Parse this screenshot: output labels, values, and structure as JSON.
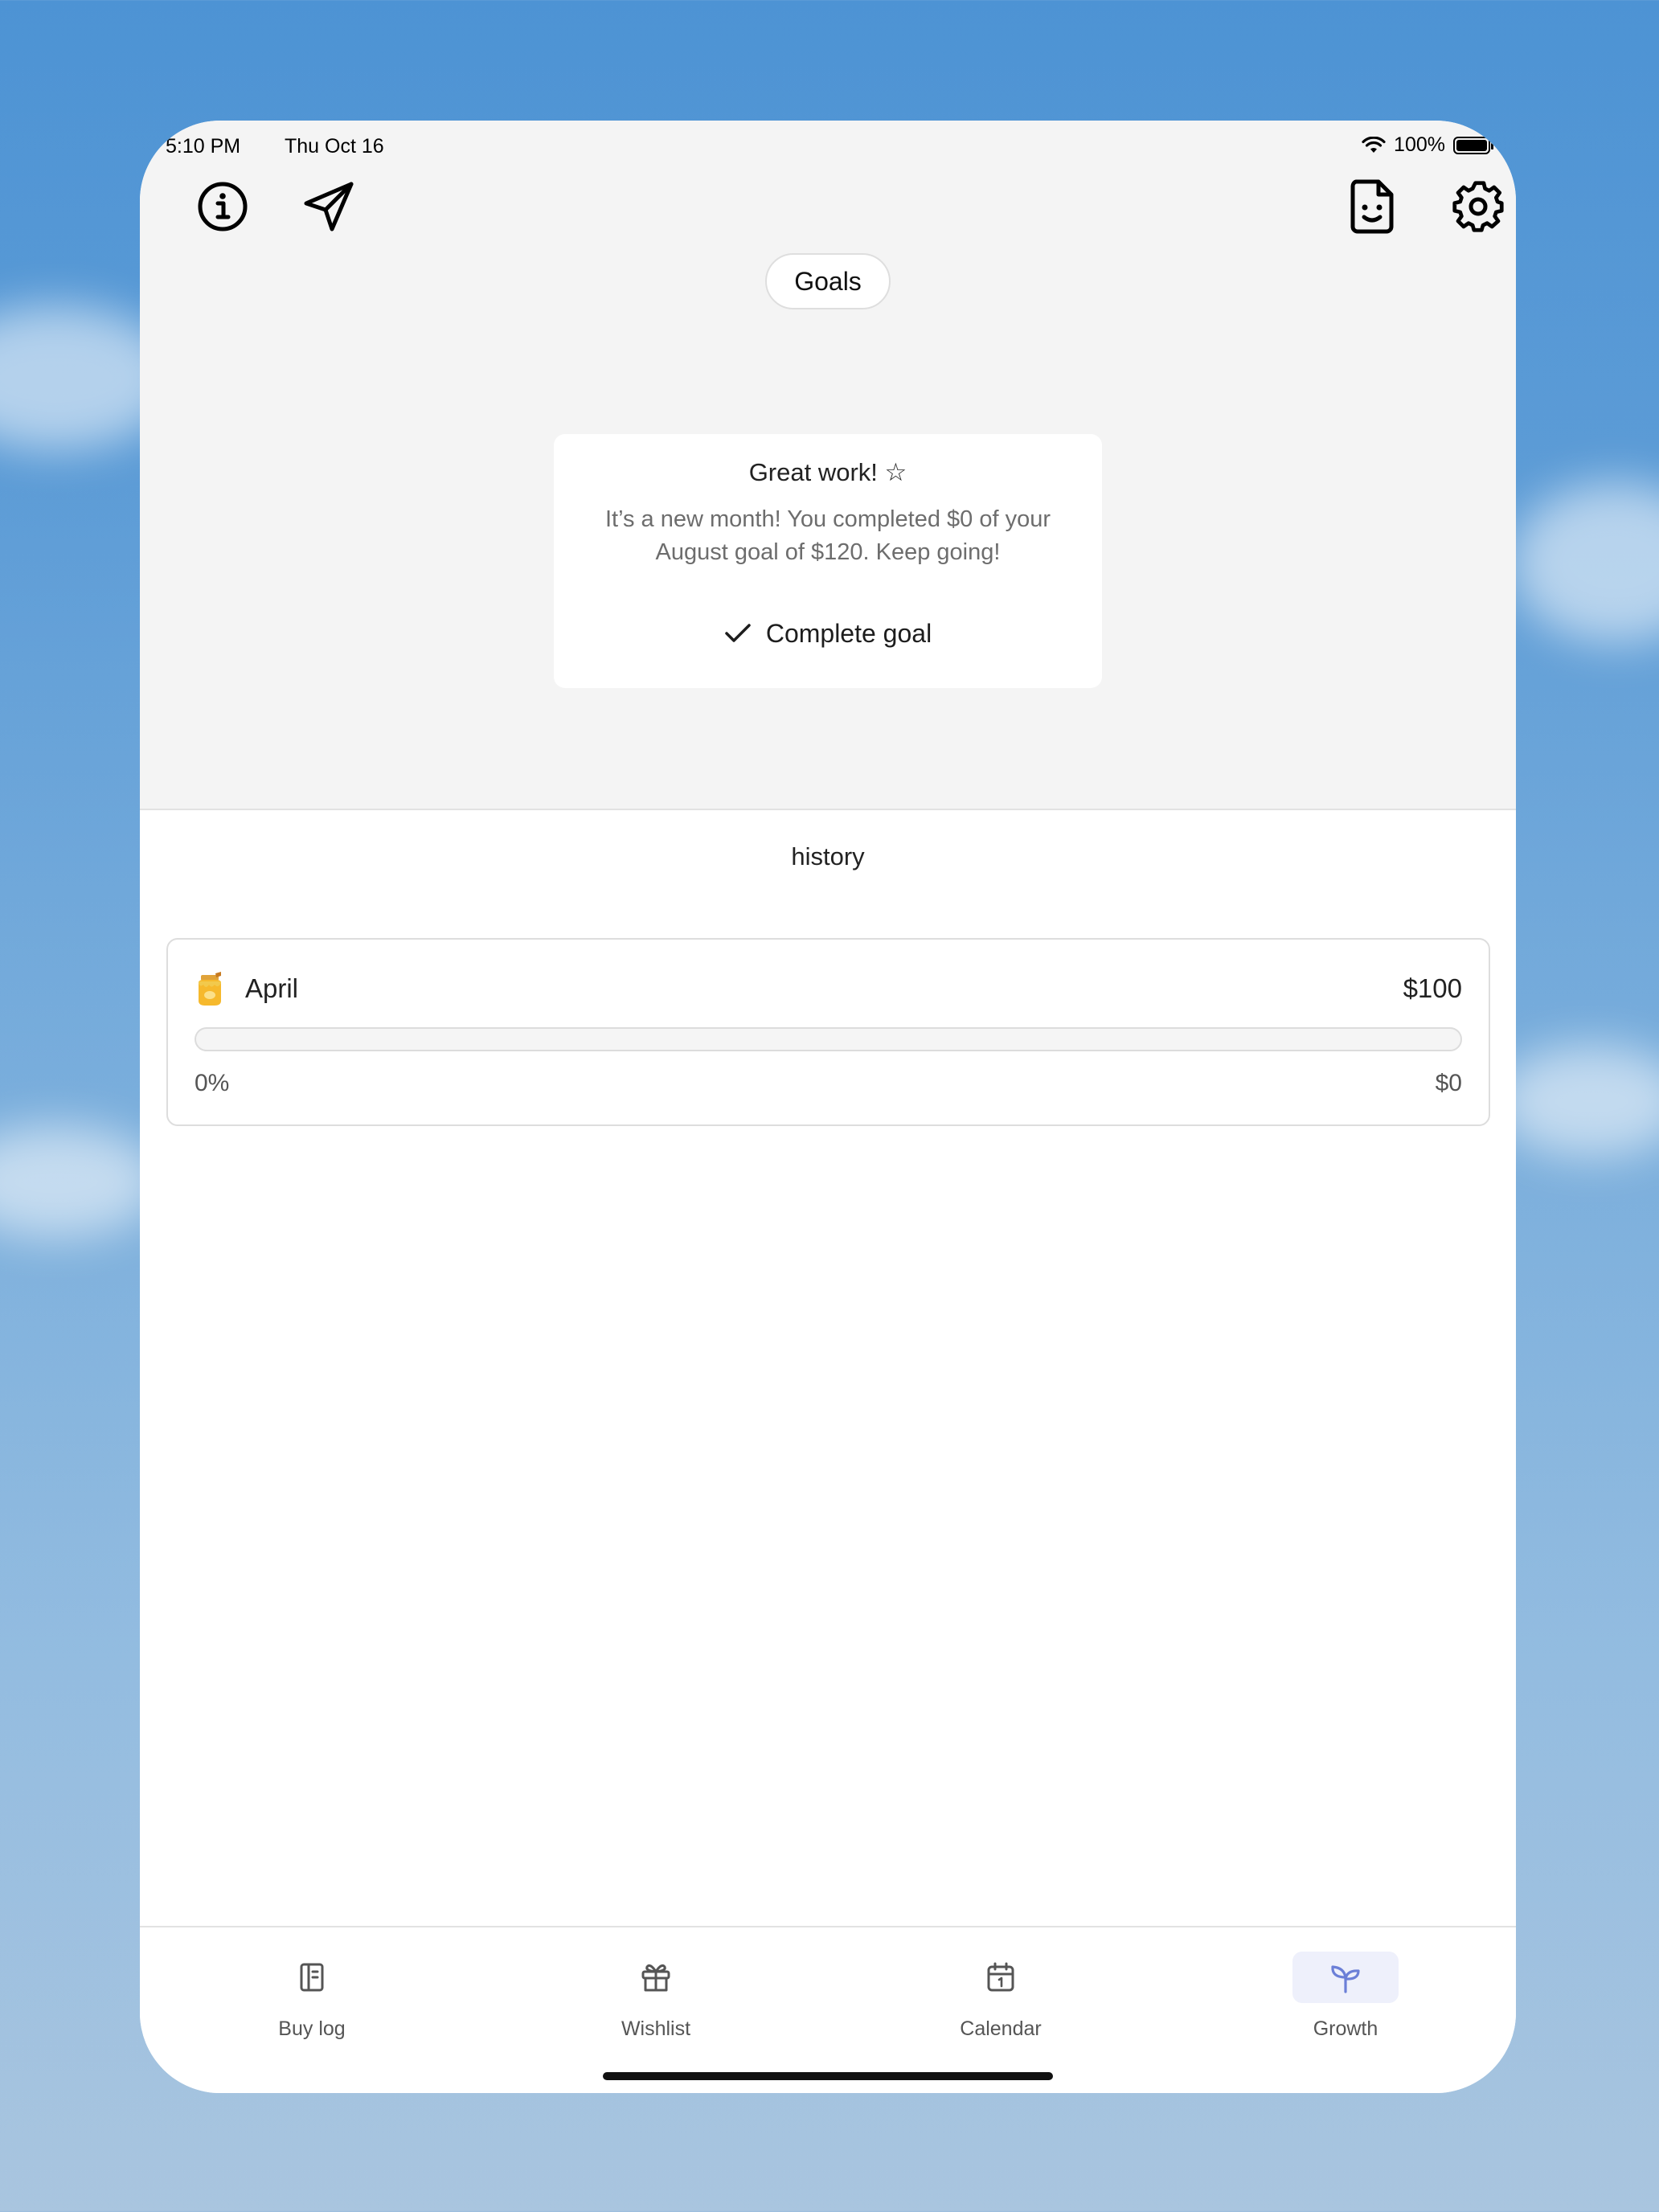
{
  "status_bar": {
    "time": "5:10 PM",
    "date": "Thu Oct 16",
    "battery": "100%"
  },
  "toolbar": {
    "left_icons": [
      "info-icon",
      "send-icon"
    ],
    "right_icons": [
      "file-smile-icon",
      "settings-icon"
    ]
  },
  "header": {
    "segment_label": "Goals"
  },
  "goal_card": {
    "title": "Great work! ☆",
    "message": "It’s a new month!  You completed $0 of your August goal of $120. Keep going!",
    "action_label": "Complete goal"
  },
  "history": {
    "title": "history",
    "items": [
      {
        "emoji": "honey-pot",
        "month": "April",
        "goal": "$100",
        "progress_label": "0%",
        "progress_fraction": 0,
        "saved": "$0"
      }
    ]
  },
  "tabbar": {
    "tabs": [
      {
        "label": "Buy log",
        "icon": "notebook-icon",
        "active": false
      },
      {
        "label": "Wishlist",
        "icon": "gift-icon",
        "active": false
      },
      {
        "label": "Calendar",
        "icon": "calendar-icon",
        "active": false
      },
      {
        "label": "Growth",
        "icon": "sprout-icon",
        "active": true
      }
    ]
  },
  "colors": {
    "accent": "#6b7fd7",
    "background": "#f4f4f4",
    "card": "#ffffff"
  }
}
